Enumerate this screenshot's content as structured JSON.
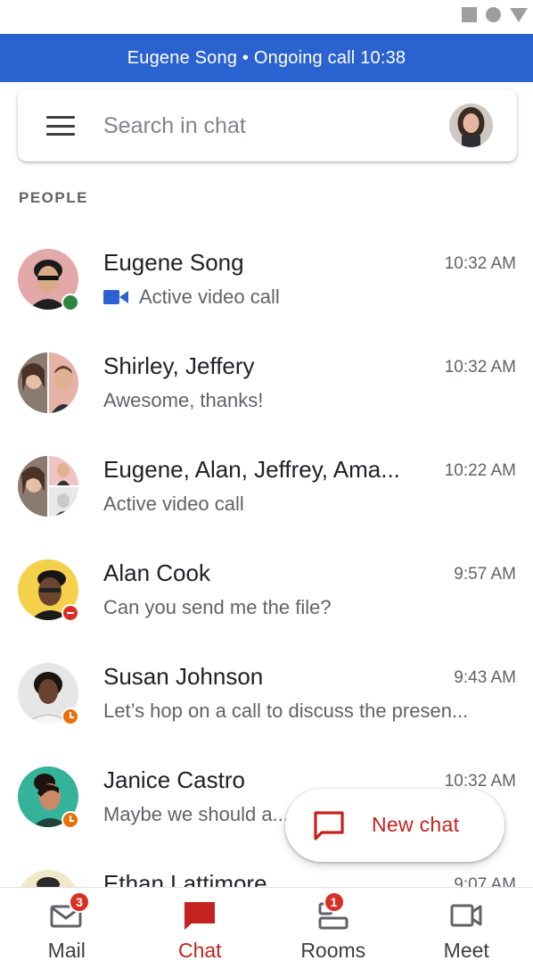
{
  "call_banner": {
    "text": "Eugene Song • Ongoing call 10:38"
  },
  "search": {
    "placeholder": "Search in chat"
  },
  "section": {
    "people_label": "PEOPLE"
  },
  "chats": [
    {
      "name": "Eugene Song",
      "time": "10:32 AM",
      "preview": "Active video call",
      "status": "online"
    },
    {
      "name": "Shirley, Jeffery",
      "time": "10:32 AM",
      "preview": "Awesome, thanks!",
      "status": ""
    },
    {
      "name": "Eugene, Alan, Jeffrey, Ama...",
      "time": "10:22 AM",
      "preview": "Active video call",
      "status": ""
    },
    {
      "name": "Alan Cook",
      "time": "9:57 AM",
      "preview": "Can you send me the file?",
      "status": "do-not-disturb"
    },
    {
      "name": "Susan Johnson",
      "time": "9:43 AM",
      "preview": "Let’s hop on a call to discuss the presen...",
      "status": "away"
    },
    {
      "name": "Janice Castro",
      "time": "10:32 AM",
      "preview": "Maybe we should a...",
      "status": "away"
    },
    {
      "name": "Ethan Lattimore",
      "time": "9:07 AM",
      "preview": "",
      "status": ""
    }
  ],
  "fab": {
    "label": "New chat"
  },
  "bottom_nav": [
    {
      "label": "Mail",
      "badge": "3"
    },
    {
      "label": "Chat",
      "badge": ""
    },
    {
      "label": "Rooms",
      "badge": "1"
    },
    {
      "label": "Meet",
      "badge": ""
    }
  ],
  "colors": {
    "accent_blue": "#2a62d0",
    "chat_red": "#c5221f",
    "online_green": "#2e8540",
    "away_orange": "#e8710a"
  }
}
